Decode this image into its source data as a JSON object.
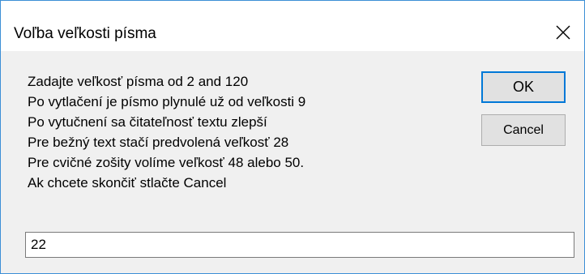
{
  "window": {
    "title": "Voľba veľkosti písma",
    "close_icon": "close-icon"
  },
  "message_lines": [
    "Zadajte veľkosť písma od 2 and 120",
    "Po vytlačení je písmo plynulé už od veľkosti 9",
    "Po vytučnení sa čitateľnosť textu zlepší",
    "Pre bežný text stačí predvolená veľkosť 28",
    "Pre cvičné zošity volíme veľkosť 48 alebo 50.",
    "Ak chcete skončiť stlačte Cancel"
  ],
  "buttons": {
    "ok_label": "OK",
    "cancel_label": "Cancel"
  },
  "input": {
    "value": "22"
  },
  "colors": {
    "window_border": "#3c8fd6",
    "dialog_bg": "#f0f0f0",
    "default_button_border": "#0078d7"
  }
}
